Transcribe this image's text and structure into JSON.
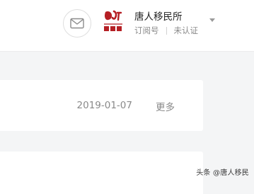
{
  "header": {
    "account_name": "唐人移民所",
    "account_type": "订阅号",
    "verification_status": "未认证",
    "avatar": {
      "logo_text_top": "唐人",
      "logo_text_bottom": "移民所",
      "brand_color": "#b51f24"
    },
    "message_icon": "envelope-icon",
    "dropdown_icon": "caret-down-icon"
  },
  "article": {
    "date": "2019-01-07",
    "more_label": "更多"
  },
  "watermark": {
    "text": "头条 @唐人移民"
  }
}
